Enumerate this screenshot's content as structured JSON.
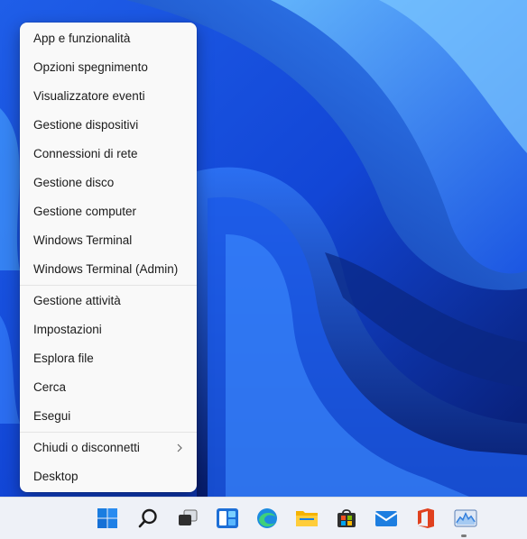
{
  "context_menu": {
    "group1": [
      {
        "label": "App e funzionalità"
      },
      {
        "label": "Opzioni spegnimento"
      },
      {
        "label": "Visualizzatore eventi"
      },
      {
        "label": "Gestione dispositivi"
      },
      {
        "label": "Connessioni di rete"
      },
      {
        "label": "Gestione disco"
      },
      {
        "label": "Gestione computer"
      },
      {
        "label": "Windows Terminal"
      },
      {
        "label": "Windows Terminal (Admin)"
      }
    ],
    "group2": [
      {
        "label": "Gestione attività"
      },
      {
        "label": "Impostazioni"
      },
      {
        "label": "Esplora file"
      },
      {
        "label": "Cerca"
      },
      {
        "label": "Esegui"
      }
    ],
    "group3": [
      {
        "label": "Chiudi o disconnetti",
        "submenu_icon": "chevron-right-icon"
      },
      {
        "label": "Desktop"
      }
    ]
  },
  "taskbar": {
    "icons": [
      "start-icon",
      "search-icon",
      "task-view-icon",
      "widgets-icon",
      "edge-icon",
      "file-explorer-icon",
      "store-icon",
      "mail-icon",
      "office-icon",
      "monitor-app-icon"
    ]
  },
  "colors": {
    "wallpaper_dark": "#0a2a8a",
    "wallpaper_light": "#4aa3ff",
    "menu_bg": "#f9f9f9",
    "taskbar_bg": "#eef1f7",
    "accent": "#0067c0"
  }
}
